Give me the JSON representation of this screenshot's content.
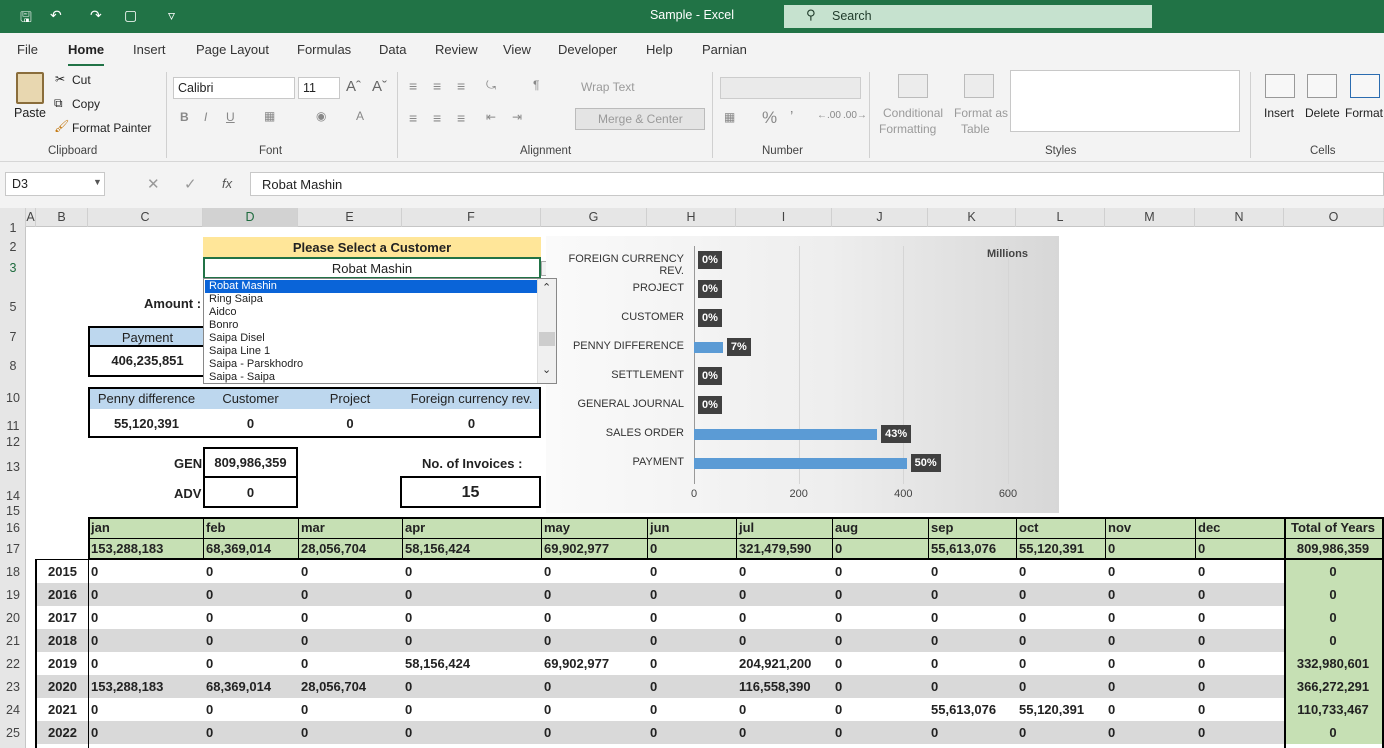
{
  "titlebar": {
    "title": "Sample  -  Excel",
    "search": "Search"
  },
  "tabs": [
    "File",
    "Home",
    "Insert",
    "Page Layout",
    "Formulas",
    "Data",
    "Review",
    "View",
    "Developer",
    "Help",
    "Parnian"
  ],
  "ribbon": {
    "clipboard": {
      "paste": "Paste",
      "cut": "Cut",
      "copy": "Copy",
      "format_painter": "Format Painter",
      "label": "Clipboard"
    },
    "font": {
      "name": "Calibri",
      "size": "11",
      "label": "Font"
    },
    "alignment": {
      "wrap": "Wrap Text",
      "merge": "Merge & Center",
      "label": "Alignment"
    },
    "number": {
      "label": "Number",
      "percent": "%"
    },
    "styles": {
      "conditional": "Conditional",
      "formatting": "Formatting",
      "format_as": "Format as",
      "table": "Table",
      "label": "Styles"
    },
    "cells": {
      "insert": "Insert",
      "delete": "Delete",
      "format": "Format",
      "label": "Cells"
    }
  },
  "formula": {
    "namebox": "D3",
    "fx": "fx",
    "value": "Robat Mashin"
  },
  "columns": [
    "A",
    "B",
    "C",
    "D",
    "E",
    "F",
    "G",
    "H",
    "I",
    "J",
    "K",
    "L",
    "M",
    "N",
    "O"
  ],
  "rows": [
    "1",
    "2",
    "3",
    "5",
    "7",
    "8",
    "10",
    "11",
    "12",
    "13",
    "14",
    "15",
    "16",
    "17",
    "18",
    "19",
    "20",
    "21",
    "22",
    "23",
    "24",
    "25"
  ],
  "sheet": {
    "select_title": "Please Select a Customer",
    "selected_customer": "Robat Mashin",
    "amount_label": "Amount :",
    "payment_header": "Payment",
    "payment_value": "406,235,851",
    "row10_headers": [
      "Penny difference",
      "Customer",
      "Project",
      "Foreign currency rev."
    ],
    "row11_values": [
      "55,120,391",
      "0",
      "0",
      "0"
    ],
    "gen_label": "GEN",
    "gen_value": "809,986,359",
    "adv_label": "ADV",
    "adv_value": "0",
    "invoices_label": "No. of Invoices :",
    "invoices_value": "15"
  },
  "dropdown": [
    "Robat Mashin",
    "Ring Saipa",
    "Aidco",
    "Bonro",
    "Saipa Disel",
    "Saipa Line 1",
    "Saipa - Parskhodro",
    "Saipa - Saipa"
  ],
  "chart_data": {
    "type": "bar",
    "orientation": "horizontal",
    "unit_label": "Millions",
    "categories": [
      "FOREIGN CURRENCY REV.",
      "PROJECT",
      "CUSTOMER",
      "PENNY DIFFERENCE",
      "SETTLEMENT",
      "GENERAL JOURNAL",
      "SALES ORDER",
      "PAYMENT"
    ],
    "values": [
      0,
      0,
      0,
      55.12,
      0,
      0,
      350,
      406.24
    ],
    "data_labels": [
      "0%",
      "0%",
      "0%",
      "7%",
      "0%",
      "0%",
      "43%",
      "50%"
    ],
    "xticks": [
      "0",
      "200",
      "400",
      "600"
    ],
    "xlim": [
      0,
      600
    ],
    "bar_color": "#5b9bd5"
  },
  "table": {
    "months": [
      "jan",
      "feb",
      "mar",
      "apr",
      "may",
      "jun",
      "jul",
      "aug",
      "sep",
      "oct",
      "nov",
      "dec"
    ],
    "total_header": "Total of Years",
    "totals": [
      "153,288,183",
      "68,369,014",
      "28,056,704",
      "58,156,424",
      "69,902,977",
      "0",
      "321,479,590",
      "0",
      "55,613,076",
      "55,120,391",
      "0",
      "0"
    ],
    "grand_total": "809,986,359",
    "years": [
      {
        "year": "2015",
        "vals": [
          "0",
          "0",
          "0",
          "0",
          "0",
          "0",
          "0",
          "0",
          "0",
          "0",
          "0",
          "0"
        ],
        "total": "0"
      },
      {
        "year": "2016",
        "vals": [
          "0",
          "0",
          "0",
          "0",
          "0",
          "0",
          "0",
          "0",
          "0",
          "0",
          "0",
          "0"
        ],
        "total": "0"
      },
      {
        "year": "2017",
        "vals": [
          "0",
          "0",
          "0",
          "0",
          "0",
          "0",
          "0",
          "0",
          "0",
          "0",
          "0",
          "0"
        ],
        "total": "0"
      },
      {
        "year": "2018",
        "vals": [
          "0",
          "0",
          "0",
          "0",
          "0",
          "0",
          "0",
          "0",
          "0",
          "0",
          "0",
          "0"
        ],
        "total": "0"
      },
      {
        "year": "2019",
        "vals": [
          "0",
          "0",
          "0",
          "58,156,424",
          "69,902,977",
          "0",
          "204,921,200",
          "0",
          "0",
          "0",
          "0",
          "0"
        ],
        "total": "332,980,601"
      },
      {
        "year": "2020",
        "vals": [
          "153,288,183",
          "68,369,014",
          "28,056,704",
          "0",
          "0",
          "0",
          "116,558,390",
          "0",
          "0",
          "0",
          "0",
          "0"
        ],
        "total": "366,272,291"
      },
      {
        "year": "2021",
        "vals": [
          "0",
          "0",
          "0",
          "0",
          "0",
          "0",
          "0",
          "0",
          "55,613,076",
          "55,120,391",
          "0",
          "0"
        ],
        "total": "110,733,467"
      },
      {
        "year": "2022",
        "vals": [
          "0",
          "0",
          "0",
          "0",
          "0",
          "0",
          "0",
          "0",
          "0",
          "0",
          "0",
          "0"
        ],
        "total": "0"
      }
    ]
  }
}
